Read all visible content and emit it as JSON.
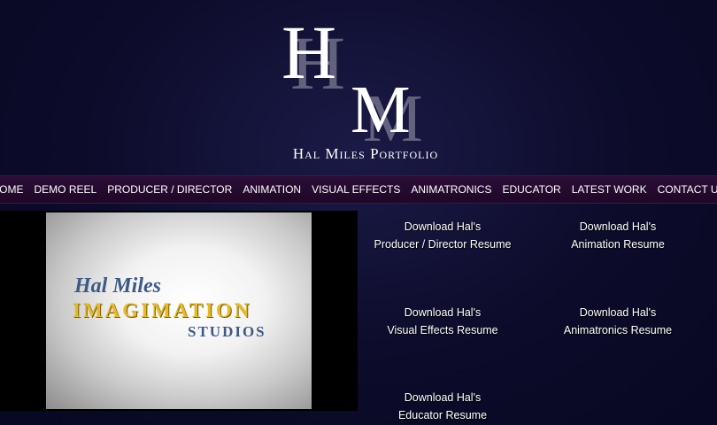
{
  "logo": {
    "h": "H",
    "m": "M"
  },
  "site_title": "Hal Miles Portfolio",
  "nav": [
    "HOME",
    "DEMO REEL",
    "PRODUCER / DIRECTOR",
    "ANIMATION",
    "VISUAL EFFECTS",
    "ANIMATRONICS",
    "EDUCATOR",
    "LATEST WORK",
    "CONTACT US"
  ],
  "reel": {
    "line1": "Hal Miles",
    "line2": "IMAGIMATION",
    "line3": "STUDIOS"
  },
  "resumes": [
    {
      "line1": "Download Hal's",
      "line2": "Producer / Director Resume"
    },
    {
      "line1": "Download Hal's",
      "line2": "Animation Resume"
    },
    {
      "line1": "Download Hal's",
      "line2": "Visual Effects Resume"
    },
    {
      "line1": "Download Hal's",
      "line2": "Animatronics Resume"
    },
    {
      "line1": "Download Hal's",
      "line2": "Educator Resume"
    }
  ]
}
